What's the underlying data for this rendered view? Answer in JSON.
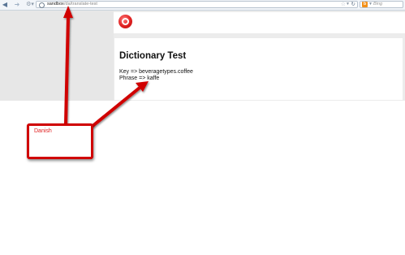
{
  "browser": {
    "url_host": "sandbox",
    "url_path": "/da/translate-test",
    "search_placeholder": "Bing",
    "search_engine_glyph": "b",
    "icons": [
      "back-icon",
      "forward-icon",
      "site-identity-icon",
      "globe-icon",
      "star-icon",
      "dropmarker-icon",
      "reload-icon",
      "search-engine-icon"
    ]
  },
  "page": {
    "title": "Dictionary Test",
    "key_line": "Key => beveragetypes.coffee",
    "phrase_line": "Phrase => kaffe"
  },
  "annotation": {
    "label": "Danish",
    "color": "#d00000"
  },
  "colors": {
    "logo": "#e02020",
    "sidebar_gray": "#e7e7e7"
  }
}
